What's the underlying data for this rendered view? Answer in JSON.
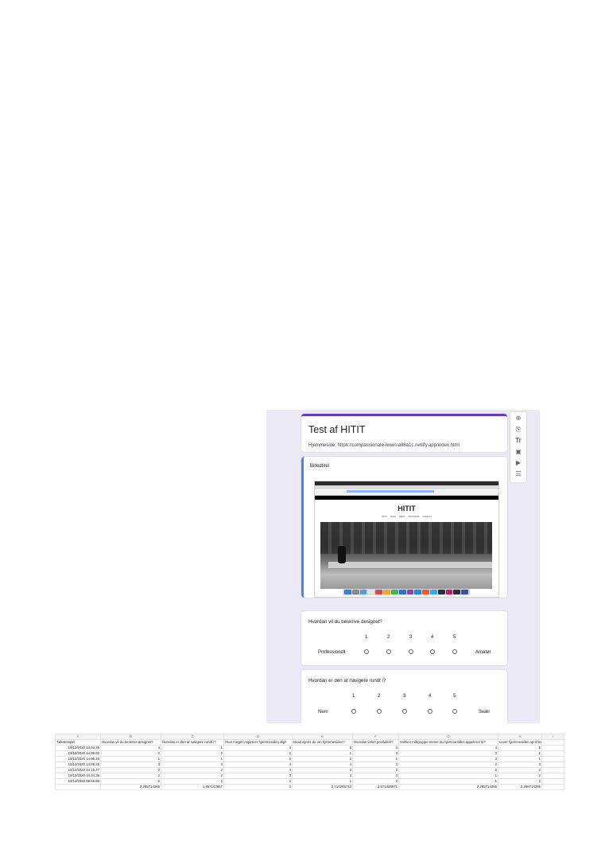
{
  "form": {
    "title": "Test af HITIT",
    "description": "Hjemmeside:  https://compassionate-lewin-a98a1c.netlify.app/index.html",
    "image_caption": "Billedtitel",
    "embedded_site_logo": "HITIT",
    "embedded_site_nav": [
      "SHOP",
      "TEAM",
      "MEDIA",
      "RETAILERS",
      "CONTACT"
    ],
    "questions": [
      {
        "title": "Hvordan vil du beskrive designet?",
        "scale": [
          "1",
          "2",
          "3",
          "4",
          "5"
        ],
        "low_label": "Professionelt",
        "high_label": "Amatør"
      },
      {
        "title": "Hvordan er den at navigere rundt i?",
        "scale": [
          "1",
          "2",
          "3",
          "4",
          "5"
        ],
        "low_label": "Nem",
        "high_label": "Svær"
      }
    ],
    "toolbar_icons": [
      "add-question-icon",
      "import-questions-icon",
      "add-title-icon",
      "add-image-icon",
      "add-video-icon",
      "add-section-icon"
    ]
  },
  "sheet": {
    "column_letters": [
      "A",
      "B",
      "C",
      "D",
      "E",
      "F",
      "G",
      "H",
      "I"
    ],
    "headers": [
      "Tidsstempel",
      "Hvordan vil du beskrive designet?",
      "Hvordan er den at navigere rundt i?",
      "Hvor meget inspirerer hjemmesiden dig?",
      "Hvad synes du om hjemmesiden?",
      "Hvordan virker produktet?",
      "Hvilken målgruppe mener du hjemmesiden appelerer til?",
      "Lever hjemmesiden op til temaet?",
      ""
    ],
    "rows": [
      [
        "10/12/2020 14.03.35",
        "4",
        "1",
        "4",
        "5",
        "4",
        "4",
        "5",
        ""
      ],
      [
        "10/12/2020 14.08.02",
        "2",
        "2",
        "2",
        "1",
        "3",
        "3",
        "1",
        ""
      ],
      [
        "10/12/2020 14.08.25",
        "1",
        "1",
        "2",
        "2",
        "1",
        "3",
        "1",
        ""
      ],
      [
        "10/12/2020 14.08.25",
        "3",
        "3",
        "4",
        "4",
        "3",
        "2",
        "3",
        ""
      ],
      [
        "10/12/2020 14.15.47",
        "2",
        "2",
        "4",
        "3",
        "2",
        "2",
        "2",
        ""
      ],
      [
        "10/12/2020 14.44.36",
        "2",
        "2",
        "3",
        "3",
        "3",
        "1",
        "2",
        ""
      ],
      [
        "10/12/2020 08.59.03",
        "2",
        "2",
        "2",
        "1",
        "2",
        "1",
        "2",
        ""
      ]
    ],
    "averages": [
      "",
      "2,285714286",
      "1,857142857",
      "3",
      "2,714285714",
      "2,571428571",
      "2,285714286",
      "2,285714286",
      ""
    ]
  }
}
